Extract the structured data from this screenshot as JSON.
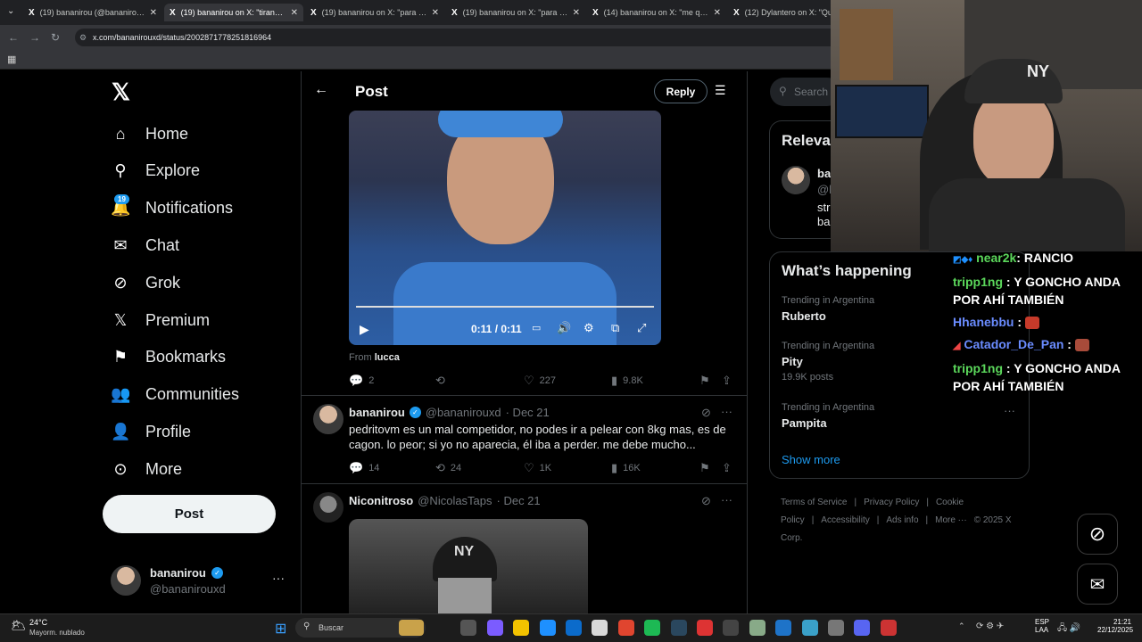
{
  "browser": {
    "tabs": [
      {
        "title": "(19) bananirou (@bananirouxd) /",
        "active": false
      },
      {
        "title": "(19) bananirou on X: \"tirando u",
        "active": true
      },
      {
        "title": "(19) bananirou on X: \"para tod",
        "active": false
      },
      {
        "title": "(19) bananirou on X: \"para tod",
        "active": false
      },
      {
        "title": "(14) bananirou on X: \"me qued",
        "active": false
      },
      {
        "title": "(12) Dylantero on X: \"Que",
        "active": false
      }
    ],
    "url": "x.com/bananirouxd/status/2002871778251816964"
  },
  "sidebar": {
    "items": [
      {
        "label": "Home",
        "icon": "home-icon",
        "glyph": "⌂"
      },
      {
        "label": "Explore",
        "icon": "search-icon",
        "glyph": "⚲"
      },
      {
        "label": "Notifications",
        "icon": "bell-icon",
        "glyph": "🔔"
      },
      {
        "label": "Chat",
        "icon": "mail-icon",
        "glyph": "✉"
      },
      {
        "label": "Grok",
        "icon": "grok-icon",
        "glyph": "⊘"
      },
      {
        "label": "Premium",
        "icon": "x-icon",
        "glyph": "𝕏"
      },
      {
        "label": "Bookmarks",
        "icon": "bookmark-icon",
        "glyph": "⚑"
      },
      {
        "label": "Communities",
        "icon": "people-icon",
        "glyph": "👥"
      },
      {
        "label": "Profile",
        "icon": "person-icon",
        "glyph": "👤"
      },
      {
        "label": "More",
        "icon": "more-circle-icon",
        "glyph": "⊙"
      }
    ],
    "notif_count": "19",
    "post_label": "Post",
    "account": {
      "name": "bananirou",
      "handle": "@bananirouxd"
    }
  },
  "header": {
    "title": "Post",
    "reply_label": "Reply"
  },
  "video": {
    "time": "0:11 / 0:11",
    "from_label": "From",
    "from_user": "lucca"
  },
  "stats1": {
    "replies": "2",
    "likes": "227",
    "views": "9.8K"
  },
  "tweet2": {
    "name": "bananirou",
    "handle": "@bananirouxd",
    "date": "· Dec 21",
    "text": "pedritovm es un mal competidor, no podes ir a pelear con 8kg mas, es de cagon. lo peor; si yo no aparecia, él iba a perder. me debe mucho...",
    "replies": "14",
    "reposts": "24",
    "likes": "1K",
    "views": "16K"
  },
  "tweet3": {
    "name": "Niconitroso",
    "handle": "@NicolasTaps",
    "date": "· Dec 21"
  },
  "right": {
    "search_placeholder": "Search",
    "relevant_title": "Releva",
    "relevant_user": "ba",
    "relevant_handle": "@b",
    "relevant_bio1": "str",
    "relevant_bio2": "ba",
    "happening_title": "What’s happening",
    "trends": [
      {
        "label": "Trending in Argentina",
        "topic": "Ruberto",
        "posts": ""
      },
      {
        "label": "Trending in Argentina",
        "topic": "Pity",
        "posts": "19.9K posts"
      },
      {
        "label": "Trending in Argentina",
        "topic": "Pampita",
        "posts": ""
      }
    ],
    "show_more": "Show more",
    "footer": [
      "Terms of Service",
      "|",
      "Privacy Policy",
      "|",
      "Cookie Policy",
      "|",
      "Accessibility",
      "|",
      "Ads info",
      "|",
      "More ···",
      "© 2025 X Corp."
    ]
  },
  "chat": [
    {
      "user": "near2k",
      "msg": ": RANCIO"
    },
    {
      "user": "tripp1ng",
      "msg": ": Y GONCHO ANDA POR AHÍ TAMBIÉN"
    },
    {
      "user": "Hhanebbu",
      "msg": ":"
    },
    {
      "user": "Catador_De_Pan",
      "msg": ":"
    },
    {
      "user": "tripp1ng",
      "msg": ": Y GONCHO ANDA POR AHÍ TAMBIÉN"
    }
  ],
  "taskbar": {
    "temp": "24°C",
    "weather": "Mayorm. nublado",
    "search": "Buscar",
    "lang1": "ESP",
    "lang2": "LAA",
    "time": "21:21",
    "date": "22/12/2025"
  }
}
